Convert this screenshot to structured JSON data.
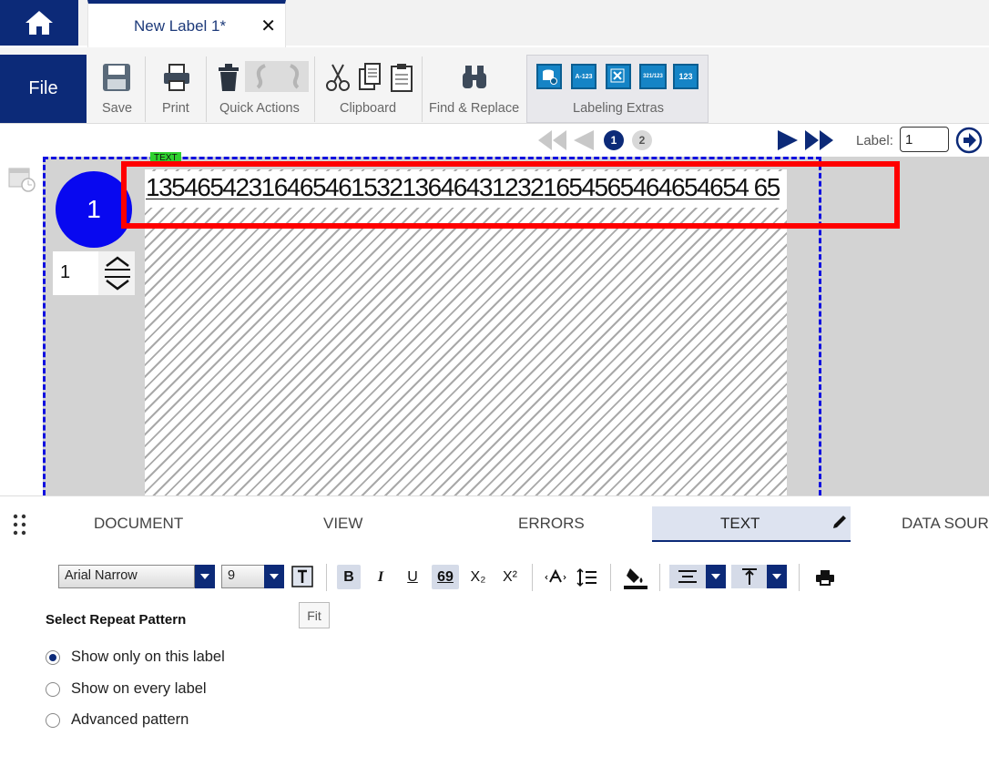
{
  "document_tab": {
    "title": "New Label 1*",
    "close": "✕"
  },
  "ribbon": {
    "file_label": "File",
    "groups": {
      "save": "Save",
      "print": "Print",
      "quick_actions": "Quick Actions",
      "clipboard": "Clipboard",
      "find_replace": "Find & Replace",
      "labeling_extras": "Labeling Extras"
    },
    "extras_icons": [
      "database-icon",
      "A-123",
      "delete-icon",
      "321/123",
      "123"
    ]
  },
  "pager": {
    "pages": [
      "1",
      "2"
    ],
    "current_page": "1",
    "label_caption": "Label:",
    "label_value": "1"
  },
  "canvas": {
    "label_number": "1",
    "copies_value": "1",
    "object_tag": "TEXT",
    "text_value": "13546542316465461532136464312321654565464654654 65"
  },
  "panel_tabs": {
    "items": [
      "DOCUMENT",
      "VIEW",
      "ERRORS",
      "TEXT",
      "DATA SOURC"
    ],
    "active": "TEXT"
  },
  "format_toolbar": {
    "font_family": "Arial Narrow",
    "font_size": "9",
    "bold": "B",
    "italic": "I",
    "underline": "U",
    "sixty_nine": "69",
    "subscript": "X₂",
    "superscript": "X²",
    "tooltip": "Fit"
  },
  "repeat_pattern": {
    "title": "Select Repeat Pattern",
    "options": [
      "Show only on this label",
      "Show on every label",
      "Advanced pattern"
    ],
    "selected": "Show only on this label"
  },
  "colors": {
    "navy": "#0c2a78",
    "highlight": "#ff0000",
    "label_circle": "#0808f0",
    "tag_green": "#2fd12f"
  }
}
